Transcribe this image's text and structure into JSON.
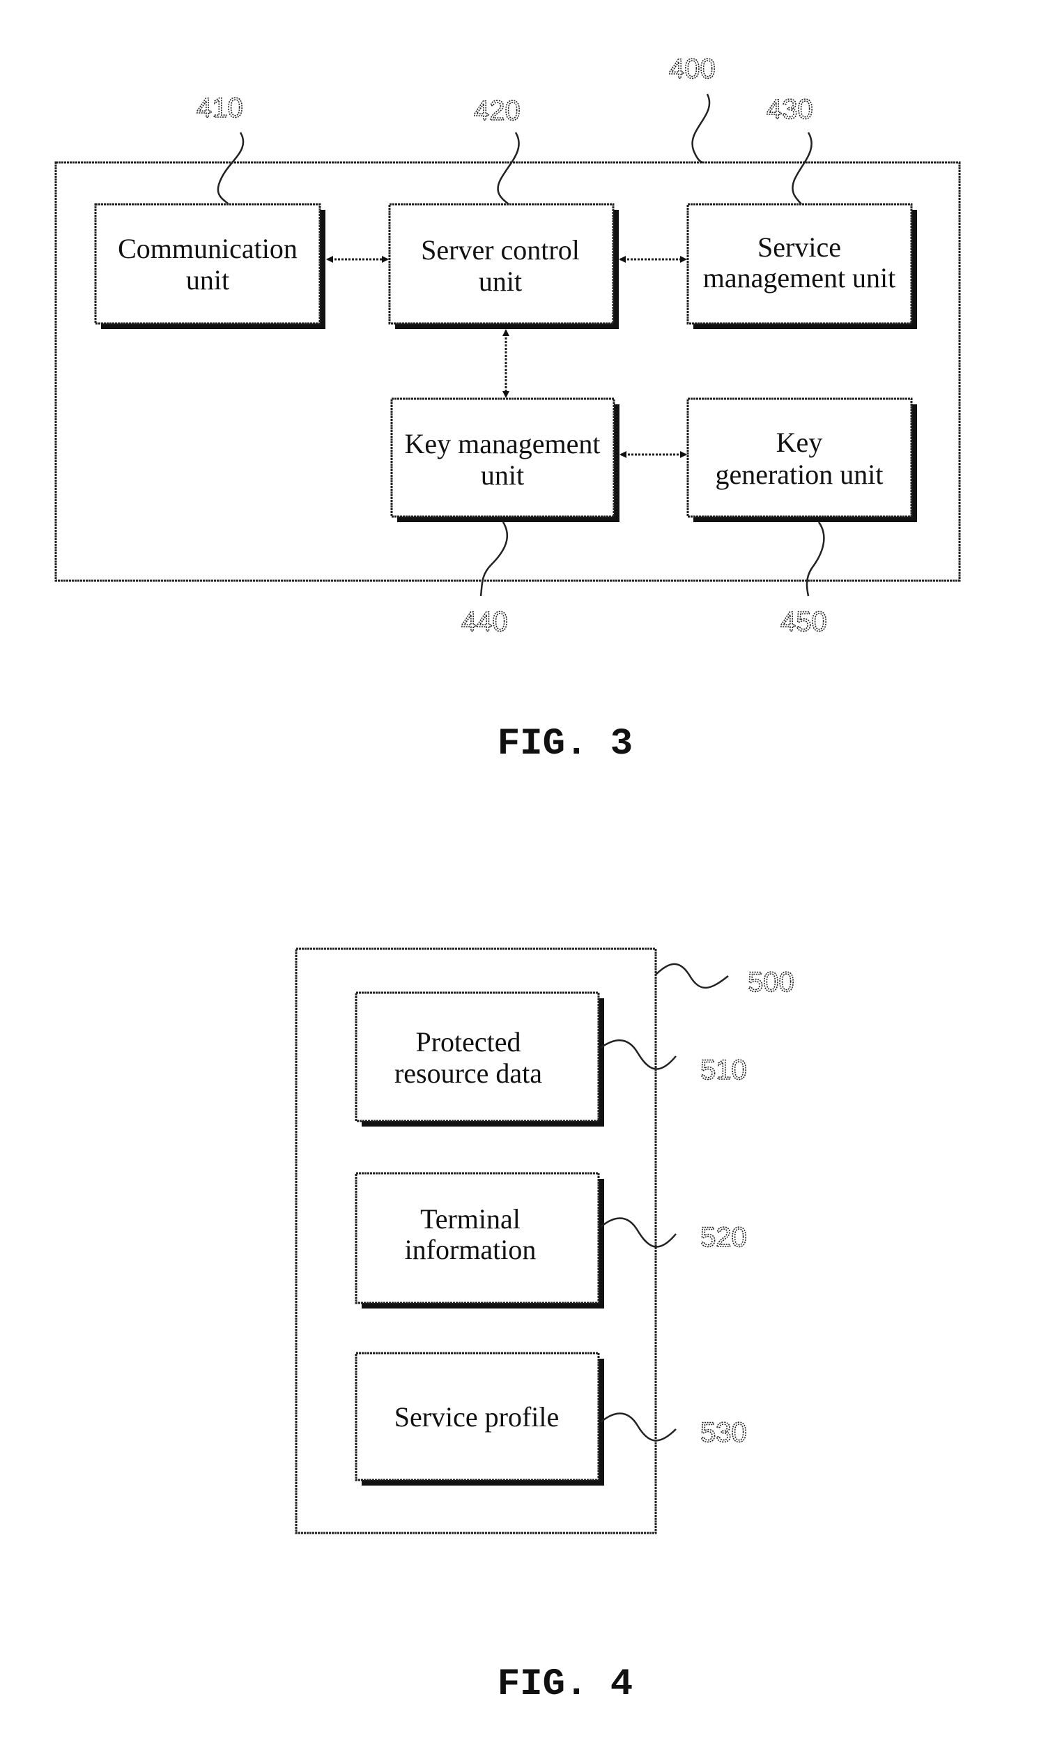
{
  "fig3": {
    "caption": "FIG. 3",
    "container_ref": "400",
    "blocks": [
      {
        "ref": "410",
        "lines": [
          "Communication",
          "unit"
        ]
      },
      {
        "ref": "420",
        "lines": [
          "Server control",
          "unit"
        ]
      },
      {
        "ref": "430",
        "lines": [
          "Service",
          "management unit"
        ]
      },
      {
        "ref": "440",
        "lines": [
          "Key management",
          "unit"
        ]
      },
      {
        "ref": "450",
        "lines": [
          "Key",
          "generation unit"
        ]
      }
    ],
    "connections": [
      {
        "from": "410",
        "to": "420",
        "type": "bidirectional"
      },
      {
        "from": "420",
        "to": "430",
        "type": "bidirectional"
      },
      {
        "from": "420",
        "to": "440",
        "type": "bidirectional"
      },
      {
        "from": "440",
        "to": "450",
        "type": "bidirectional"
      }
    ]
  },
  "fig4": {
    "caption": "FIG. 4",
    "container_ref": "500",
    "blocks": [
      {
        "ref": "510",
        "lines": [
          "Protected",
          "resource data"
        ]
      },
      {
        "ref": "520",
        "lines": [
          "Terminal",
          "information"
        ]
      },
      {
        "ref": "530",
        "lines": [
          "Service profile"
        ]
      }
    ]
  }
}
